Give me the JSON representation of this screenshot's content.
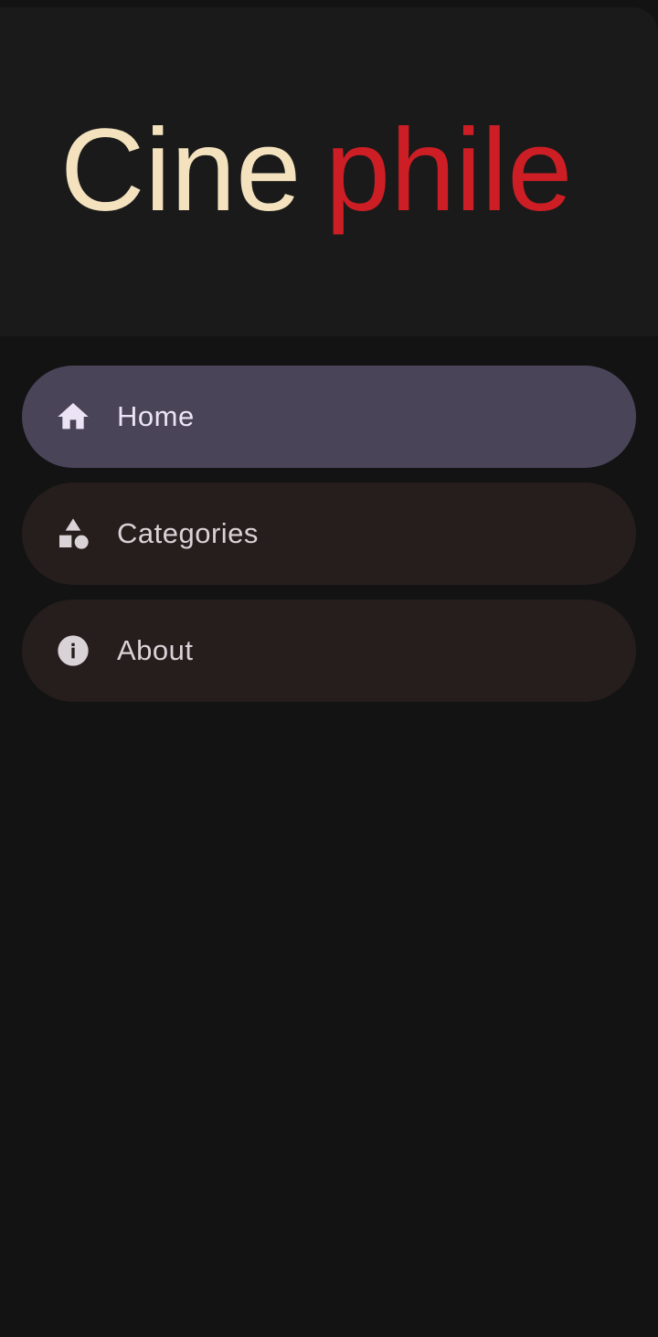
{
  "app": {
    "logo": {
      "text_part1": "Cine",
      "text_part2": "phile",
      "color_part1": "#f3e2bd",
      "color_part2": "#cc1e24"
    }
  },
  "nav": {
    "items": [
      {
        "label": "Home",
        "icon": "home-icon",
        "active": true
      },
      {
        "label": "Categories",
        "icon": "category-shapes-icon",
        "active": false
      },
      {
        "label": "About",
        "icon": "info-icon",
        "active": false
      }
    ]
  },
  "colors": {
    "background": "#131313",
    "header_background": "#1a1a1a",
    "active_item": "#4a4459",
    "inactive_item": "#261d1d"
  }
}
